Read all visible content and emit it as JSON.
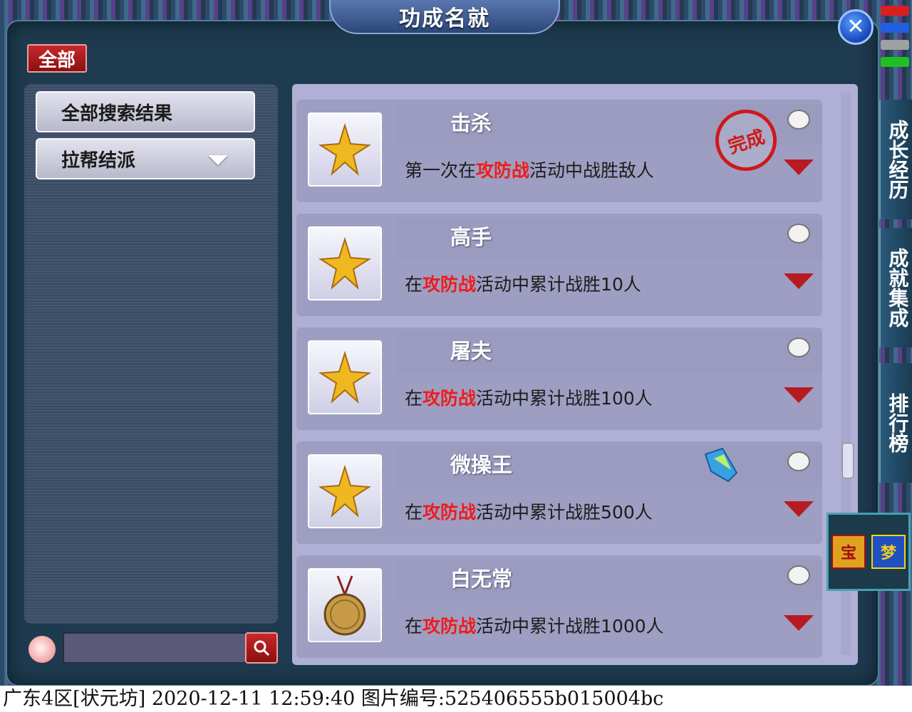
{
  "window": {
    "title": "功成名就",
    "close_icon": "close-x-icon"
  },
  "category_tab": "全部",
  "sidebar": {
    "items": [
      {
        "label": "全部搜索结果",
        "icon": "swirl-ornament-icon"
      },
      {
        "label": "拉帮结派",
        "icon": "chevron-down-icon"
      }
    ]
  },
  "search": {
    "value": "",
    "peach_icon": "peach-icon",
    "button_icon": "search-icon"
  },
  "achievements": [
    {
      "name": "击杀",
      "desc_pre": "第一次在",
      "desc_hl": "攻防战",
      "desc_post": "活动中战胜敌人",
      "icon": "gold-star-icon",
      "completed_seal": "完成"
    },
    {
      "name": "高手",
      "desc_pre": "在",
      "desc_hl": "攻防战",
      "desc_post": "活动中累计战胜10人",
      "icon": "gold-star-icon"
    },
    {
      "name": "屠夫",
      "desc_pre": "在",
      "desc_hl": "攻防战",
      "desc_post": "活动中累计战胜100人",
      "icon": "gold-star-icon"
    },
    {
      "name": "微操王",
      "desc_pre": "在",
      "desc_hl": "攻防战",
      "desc_post": "活动中累计战胜500人",
      "icon": "gold-star-icon",
      "extra_icon": "blue-gem-icon"
    },
    {
      "name": "白无常",
      "desc_pre": "在",
      "desc_hl": "攻防战",
      "desc_post": "活动中累计战胜1000人",
      "icon": "bronze-medal-icon"
    }
  ],
  "right_tabs": [
    {
      "label": "成长经历"
    },
    {
      "label": "成就集成"
    },
    {
      "label": "排行榜"
    }
  ],
  "corner_widget": {
    "left_label": "宝",
    "right_label": "梦"
  },
  "watermark": "广东4区[状元坊] 2020-12-11 12:59:40 图片编号:525406555b015004bc",
  "colors": {
    "highlight": "#ee1c1c",
    "panel": "#b0b0d6",
    "frame": "#1e3a4e"
  }
}
